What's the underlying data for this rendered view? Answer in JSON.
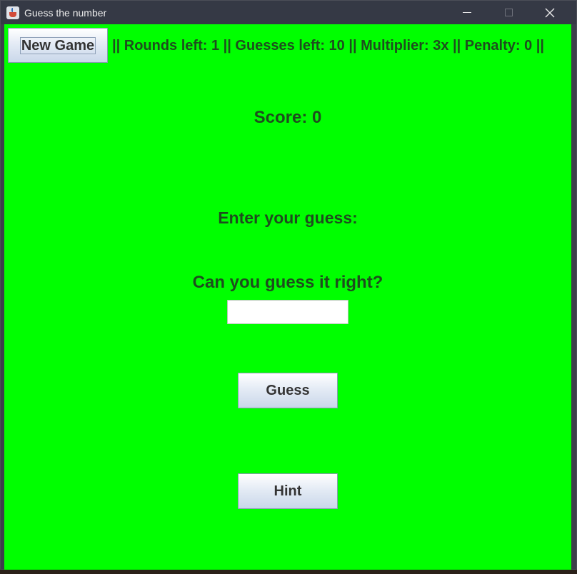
{
  "window": {
    "title": "Guess the number",
    "controls": {
      "minimize": "minimize-icon",
      "maximize": "maximize-icon",
      "close": "close-icon"
    }
  },
  "toolbar": {
    "new_game_label": "New Game",
    "status_text": "|| Rounds left: 1 || Guesses left: 10 || Multiplier: 3x || Penalty: 0 ||"
  },
  "main": {
    "score_text": "Score: 0",
    "prompt_text": "Enter your guess:",
    "message_text": "Can you guess it right?",
    "guess_input_value": "",
    "guess_button_label": "Guess",
    "hint_button_label": "Hint"
  },
  "colors": {
    "background": "#00ff00",
    "label_text": "#1e4d1e",
    "titlebar": "#353945"
  }
}
